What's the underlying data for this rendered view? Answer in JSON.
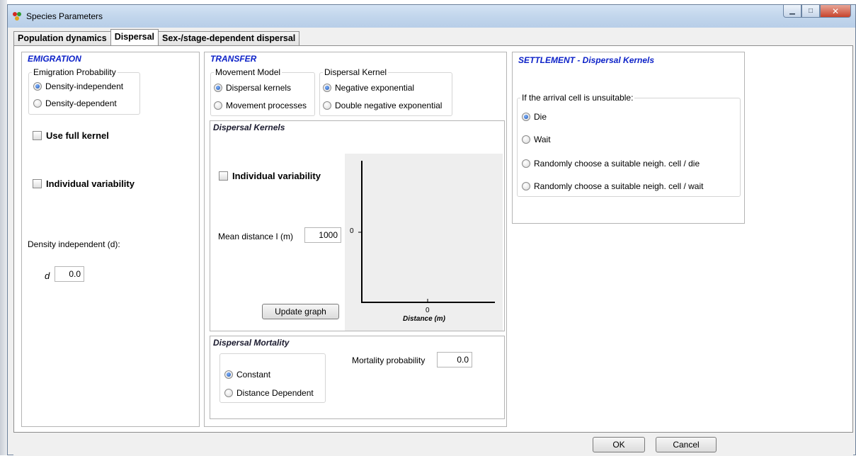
{
  "window": {
    "title": "Species Parameters",
    "controls": [
      "minimize",
      "maximize",
      "close"
    ]
  },
  "tabs": [
    "Population dynamics",
    "Dispersal",
    "Sex-/stage-dependent dispersal"
  ],
  "active_tab": "Dispersal",
  "emigration": {
    "title": "EMIGRATION",
    "probability_group": "Emigration Probability",
    "options": [
      "Density-independent",
      "Density-dependent"
    ],
    "selected": "Density-independent",
    "use_full_kernel": "Use full kernel",
    "individual_variability": "Individual variability",
    "density_label": "Density independent (d):",
    "d_symbol": "d",
    "d_value": "0.0"
  },
  "transfer": {
    "title": "TRANSFER",
    "movement_group": "Movement Model",
    "movement_options": [
      "Dispersal kernels",
      "Movement processes"
    ],
    "movement_selected": "Dispersal kernels",
    "kernel_group": "Dispersal Kernel",
    "kernel_options": [
      "Negative exponential",
      "Double negative exponential"
    ],
    "kernel_selected": "Negative exponential",
    "kernels_panel": {
      "title": "Dispersal Kernels",
      "individual_variability": "Individual variability",
      "mean_distance_label": "Mean distance I (m)",
      "mean_distance_value": "1000",
      "update_button": "Update graph",
      "graph": {
        "y_tick": "0",
        "x_tick": "0",
        "x_label": "Distance (m)"
      }
    },
    "mortality_panel": {
      "title": "Dispersal Mortality",
      "options": [
        "Constant",
        "Distance Dependent"
      ],
      "selected": "Constant",
      "probability_label": "Mortality probability",
      "probability_value": "0.0"
    }
  },
  "settlement": {
    "title": "SETTLEMENT - Dispersal Kernels",
    "group_label": "If the arrival cell is unsuitable:",
    "options": [
      "Die",
      "Wait",
      "Randomly choose a suitable neigh. cell / die",
      "Randomly choose a suitable neigh. cell / wait"
    ],
    "selected": "Die"
  },
  "footer": {
    "ok": "OK",
    "cancel": "Cancel"
  },
  "colors": {
    "section_title": "#0d22c8",
    "title_bar": "#c2d6ec"
  }
}
